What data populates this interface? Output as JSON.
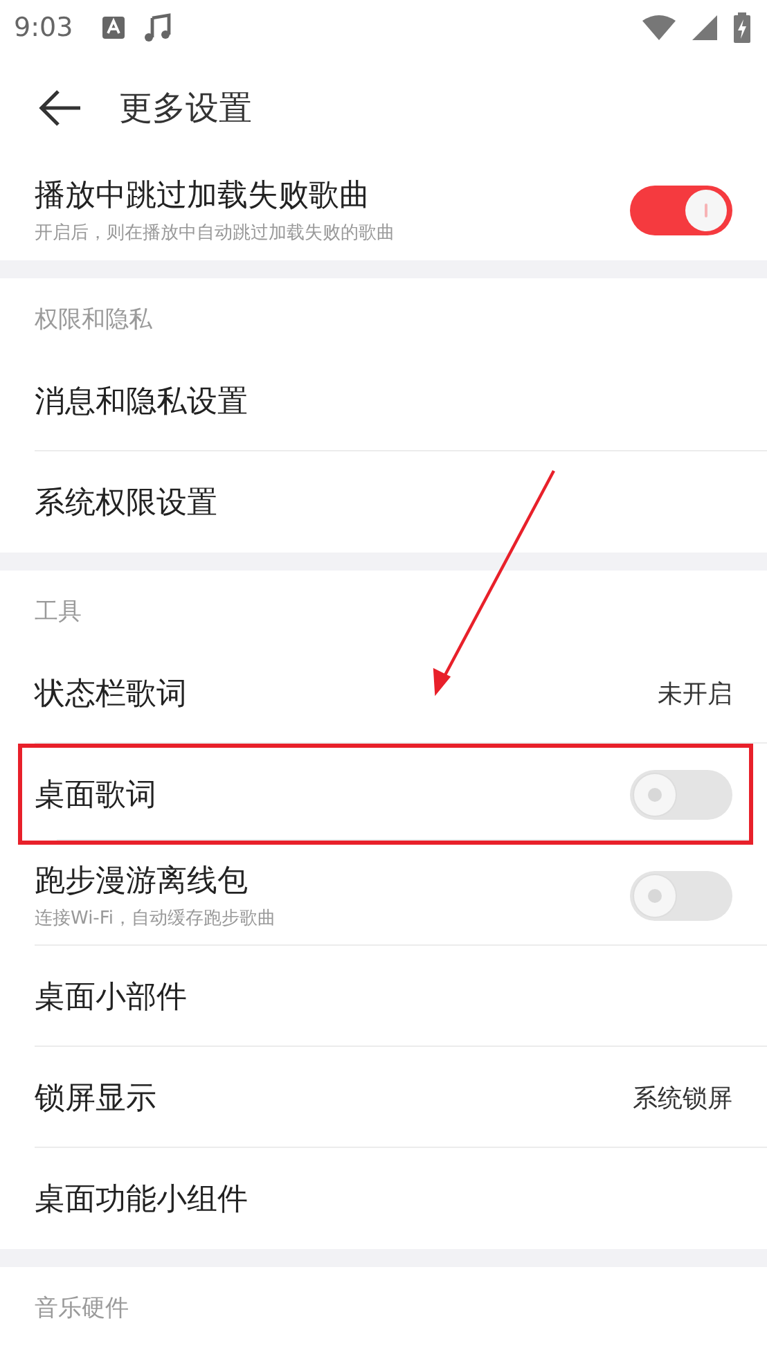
{
  "status_bar": {
    "time": "9:03"
  },
  "header": {
    "title": "更多设置"
  },
  "sections": [
    {
      "items": [
        {
          "kind": "toggle",
          "label": "播放中跳过加载失败歌曲",
          "subtitle": "开启后，则在播放中自动跳过加载失败的歌曲",
          "on": true,
          "highlighted": false
        }
      ]
    },
    {
      "label": "权限和隐私",
      "items": [
        {
          "kind": "nav",
          "label": "消息和隐私设置",
          "highlighted": false
        },
        {
          "kind": "nav",
          "label": "系统权限设置",
          "highlighted": false
        }
      ]
    },
    {
      "label": "工具",
      "items": [
        {
          "kind": "value",
          "label": "状态栏歌词",
          "value": "未开启",
          "highlighted": false
        },
        {
          "kind": "toggle",
          "label": "桌面歌词",
          "on": false,
          "highlighted": true
        },
        {
          "kind": "toggle",
          "label": "跑步漫游离线包",
          "subtitle": "连接Wi-Fi，自动缓存跑步歌曲",
          "on": false,
          "highlighted": false
        },
        {
          "kind": "nav",
          "label": "桌面小部件",
          "highlighted": false
        },
        {
          "kind": "value",
          "label": "锁屏显示",
          "value": "系统锁屏",
          "highlighted": false
        },
        {
          "kind": "nav",
          "label": "桌面功能小组件",
          "highlighted": false
        }
      ]
    },
    {
      "label": "音乐硬件"
    }
  ],
  "annotation": {
    "arrow": true
  }
}
